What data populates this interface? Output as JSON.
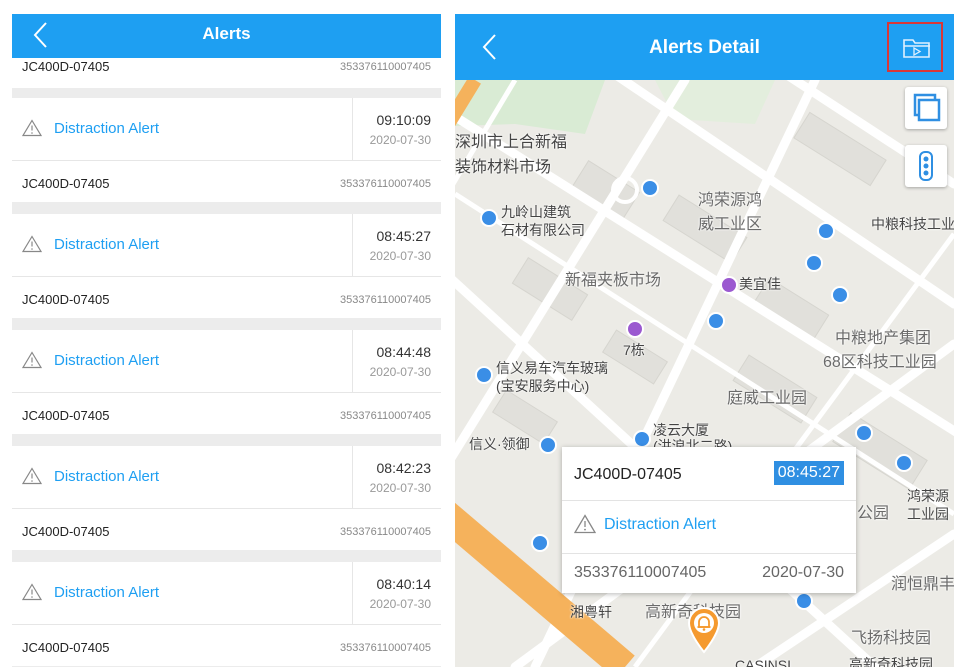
{
  "alerts_screen": {
    "title": "Alerts",
    "top_row": {
      "device": "JC400D-07405",
      "imei": "353376110007405"
    },
    "items": [
      {
        "type": "Distraction Alert",
        "time": "09:10:09",
        "date": "2020-07-30",
        "device": "JC400D-07405",
        "imei": "353376110007405"
      },
      {
        "type": "Distraction Alert",
        "time": "08:45:27",
        "date": "2020-07-30",
        "device": "JC400D-07405",
        "imei": "353376110007405"
      },
      {
        "type": "Distraction Alert",
        "time": "08:44:48",
        "date": "2020-07-30",
        "device": "JC400D-07405",
        "imei": "353376110007405"
      },
      {
        "type": "Distraction Alert",
        "time": "08:42:23",
        "date": "2020-07-30",
        "device": "JC400D-07405",
        "imei": "353376110007405"
      },
      {
        "type": "Distraction Alert",
        "time": "08:40:14",
        "date": "2020-07-30",
        "device": "JC400D-07405",
        "imei": "353376110007405"
      }
    ]
  },
  "detail_screen": {
    "title": "Alerts Detail",
    "info": {
      "device": "JC400D-07405",
      "time": "08:45:27",
      "type": "Distraction Alert",
      "imei": "353376110007405",
      "date": "2020-07-30"
    },
    "map_labels": {
      "l1": "深圳市上合新福",
      "l2": "装饰材料市场",
      "l3": "鸿荣源鸿",
      "l4": "威工业区",
      "l5": "九岭山建筑",
      "l6": "石材有限公司",
      "l7": "中粮科技工业",
      "l8": "新福夹板市场",
      "l9": "美宜佳",
      "l10": "中粮地产集团",
      "l11": "68区科技工业园",
      "l12": "7栋",
      "l13": "信义易车汽车玻璃",
      "l14": "(宝安服务中心)",
      "l15": "庭威工业园",
      "l16": "凌云大厦",
      "l17": "(洪浪北二路)",
      "l18": "信义·领御",
      "l19": "鸿荣源",
      "l20": "工业园",
      "l21": "公园",
      "l22": "润恒鼎丰",
      "l23": "湘粤轩",
      "l24": "高新奇科技园",
      "l25": "飞扬科技园",
      "l26": "高新奇科技园",
      "l27": "CASINSI"
    }
  },
  "colors": {
    "header_blue": "#1e9ff2",
    "alert_blue": "#1e9ff2",
    "highlight_red": "#d93636",
    "marker_orange": "#f59a2f",
    "road_orange": "#f5b25c"
  },
  "icons": {
    "back": "chevron-left-icon",
    "warning": "warning-triangle-icon",
    "folder": "folder-play-icon",
    "layers": "layers-icon",
    "traffic": "traffic-light-icon",
    "alert_marker": "bell-marker-icon"
  }
}
